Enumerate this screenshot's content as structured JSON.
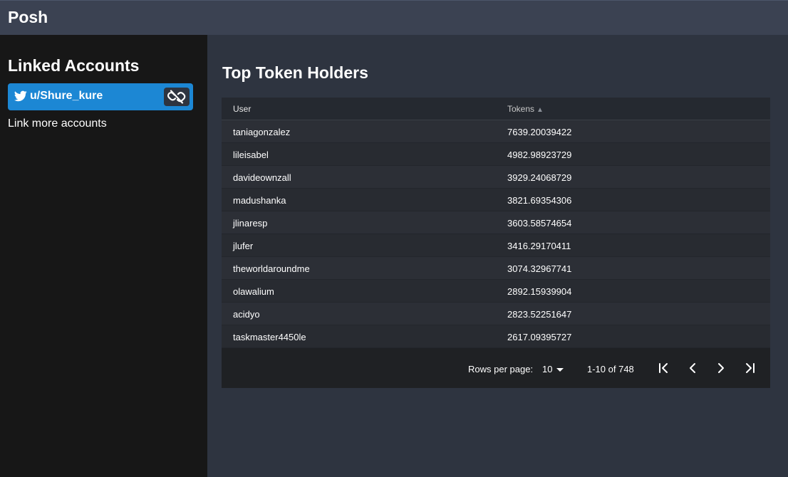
{
  "app": {
    "brand": "Posh"
  },
  "sidebar": {
    "heading": "Linked Accounts",
    "account": {
      "icon": "twitter-icon",
      "name": "u/Shure_kure",
      "action_icon": "unlink-icon"
    },
    "link_more": "Link more accounts"
  },
  "main": {
    "title": "Top Token Holders",
    "table": {
      "columns": [
        "User",
        "Tokens"
      ],
      "sort_indicator": "▲",
      "rows": [
        {
          "user": "taniagonzalez",
          "tokens": "7639.20039422"
        },
        {
          "user": "lileisabel",
          "tokens": "4982.98923729"
        },
        {
          "user": "davideownzall",
          "tokens": "3929.24068729"
        },
        {
          "user": "madushanka",
          "tokens": "3821.69354306"
        },
        {
          "user": "jlinaresp",
          "tokens": "3603.58574654"
        },
        {
          "user": "jlufer",
          "tokens": "3416.29170411"
        },
        {
          "user": "theworldaroundme",
          "tokens": "3074.32967741"
        },
        {
          "user": "olawalium",
          "tokens": "2892.15939904"
        },
        {
          "user": "acidyo",
          "tokens": "2823.52251647"
        },
        {
          "user": "taskmaster4450le",
          "tokens": "2617.09395727"
        }
      ]
    },
    "pagination": {
      "rows_per_page_label": "Rows per page:",
      "rows_per_page": "10",
      "range": "1-10 of 748",
      "buttons": [
        "first-page-icon",
        "prev-page-icon",
        "next-page-icon",
        "last-page-icon"
      ]
    }
  },
  "colors": {
    "accent": "#1c87d4",
    "topbar": "#3b4252",
    "sidebar": "#171717",
    "background": "#2e3440"
  }
}
